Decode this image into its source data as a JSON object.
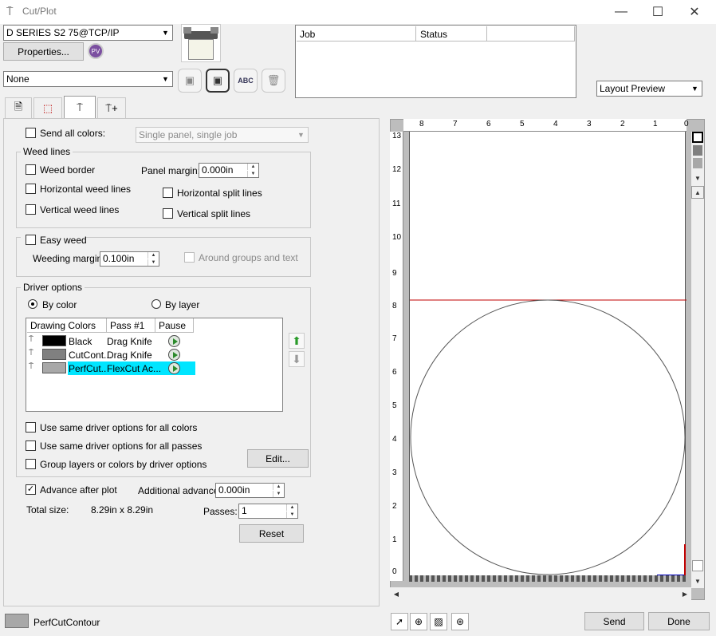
{
  "window": {
    "title": "Cut/Plot",
    "minimize": "—",
    "maximize": "☐",
    "close": "✕"
  },
  "device": {
    "selected": "D SERIES S2 75@TCP/IP",
    "properties_label": "Properties...",
    "preset": "None"
  },
  "jobs": {
    "col_job": "Job",
    "col_status": "Status"
  },
  "view_mode": "Layout Preview",
  "send_all_colors": {
    "label": "Send all colors:",
    "checked": false,
    "mode": "Single panel, single job"
  },
  "weed_lines": {
    "title": "Weed lines",
    "weed_border": "Weed border",
    "panel_margin_label": "Panel margin:",
    "panel_margin": "0.000in",
    "horizontal_weed": "Horizontal weed lines",
    "horizontal_split": "Horizontal split lines",
    "vertical_weed": "Vertical weed lines",
    "vertical_split": "Vertical split lines"
  },
  "easy_weed": {
    "label": "Easy weed",
    "margin_label": "Weeding margin:",
    "margin": "0.100in",
    "around_groups": "Around groups and text"
  },
  "driver_options": {
    "title": "Driver options",
    "by_color": "By color",
    "by_layer": "By layer",
    "columns": [
      "Drawing Colors",
      "Pass #1",
      "Pause"
    ],
    "rows": [
      {
        "color_name": "Black",
        "swatch": "#000000",
        "pass": "Drag Knife",
        "selected": false
      },
      {
        "color_name": "CutCont...",
        "swatch": "#808080",
        "pass": "Drag Knife",
        "selected": false
      },
      {
        "color_name": "PerfCut...",
        "swatch": "#a8a8a8",
        "pass": "FlexCut Ac...",
        "selected": true
      }
    ],
    "same_all_colors": "Use same driver options for all colors",
    "same_all_passes": "Use same driver options for all passes",
    "group_layers": "Group layers or colors by driver options",
    "edit_label": "Edit..."
  },
  "advance": {
    "label": "Advance after plot",
    "checked": true,
    "additional_label": "Additional advance:",
    "additional": "0.000in",
    "total_size_label": "Total size:",
    "total_size": "8.29in x  8.29in",
    "passes_label": "Passes:",
    "passes": "1",
    "reset_label": "Reset"
  },
  "ruler": {
    "top": [
      "8",
      "7",
      "6",
      "5",
      "4",
      "3",
      "2",
      "1",
      "0"
    ],
    "left": [
      "13",
      "12",
      "11",
      "10",
      "9",
      "8",
      "7",
      "6",
      "5",
      "4",
      "3",
      "2",
      "1",
      "0"
    ]
  },
  "colors": {
    "selection": "#00e5ff",
    "cut_line": "#c00000",
    "arrow_x": "#0000c0",
    "arrow_y": "#c00000"
  },
  "status_bar": {
    "current_color": "PerfCutContour",
    "swatch": "#a8a8a8"
  },
  "actions": {
    "send": "Send",
    "done": "Done"
  }
}
